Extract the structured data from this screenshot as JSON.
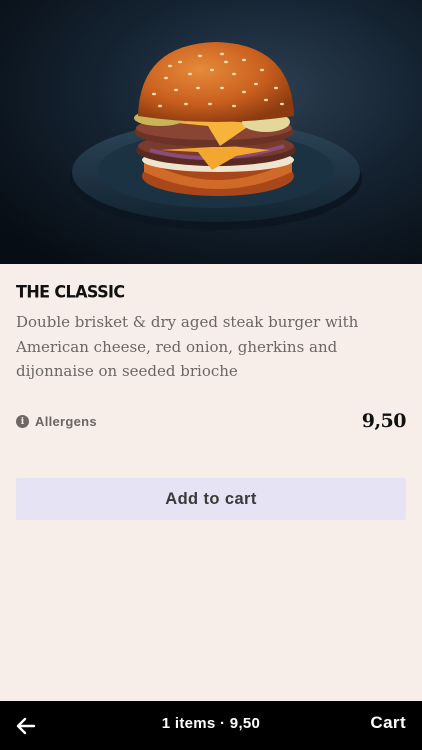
{
  "product": {
    "image_icon": "burger-photo",
    "name": "THE CLASSIC",
    "description": "Double brisket & dry aged steak burger with American cheese, red onion, gherkins and dijonnaise on seeded brioche",
    "allergens_label": "Allergens",
    "allergens_icon": "info-icon",
    "price": "9,50",
    "add_to_cart_label": "Add to cart"
  },
  "bottom_bar": {
    "back_icon": "arrow-left-icon",
    "summary": "1 items · 9,50",
    "cart_label": "Cart"
  },
  "colors": {
    "page_background": "#f8eee9",
    "button_background": "#e6e4f4",
    "bar_background": "#000000"
  }
}
